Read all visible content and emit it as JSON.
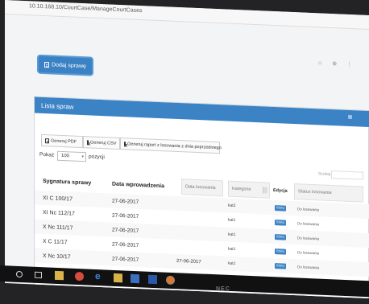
{
  "browser": {
    "url": "10.10.168.10/CourtCase/ManageCourtCases"
  },
  "toolbar": {
    "add_case_label": "Dodaj sprawę"
  },
  "panel": {
    "title": "Lista spraw",
    "export_pdf": "Generuj PDF",
    "export_csv": "Generuj CSV",
    "export_report": "Generuj raport z losowania z dnia poprzedniego",
    "show_label": "Pokaż",
    "page_size": "100",
    "entries_label": "pozycji",
    "search_label": "Szukaj"
  },
  "table": {
    "headers": {
      "signature": "Sygnatura sprawy",
      "date_entered": "Data wprowadzenia",
      "date_drawn": "Data losowania",
      "category": "Kategorie",
      "edit": "Edycja",
      "status": "Status losowania"
    },
    "rows": [
      {
        "signature": "XI C 100/17",
        "date_entered": "27-06-2017",
        "date_drawn": "",
        "category": "kat2",
        "edit": "Edytuj",
        "status": "Do losowania"
      },
      {
        "signature": "XI Nc 112/17",
        "date_entered": "27-06-2017",
        "date_drawn": "",
        "category": "kat1",
        "edit": "Edytuj",
        "status": "Do losowania"
      },
      {
        "signature": "X Nc 111/17",
        "date_entered": "27-06-2017",
        "date_drawn": "",
        "category": "kat1",
        "edit": "Edytuj",
        "status": "Do losowania"
      },
      {
        "signature": "X C 11/17",
        "date_entered": "27-06-2017",
        "date_drawn": "",
        "category": "kat1",
        "edit": "Edytuj",
        "status": "Do losowania"
      },
      {
        "signature": "X Nc 10/17",
        "date_entered": "27-06-2017",
        "date_drawn": "27-06-2017",
        "category": "kat1",
        "edit": "Edytuj",
        "status": "Do losowania"
      },
      {
        "signature": "X Nc 8/17",
        "date_entered": "27-06-2017",
        "date_drawn": "",
        "category": "kat1",
        "edit": "",
        "status": "Brak pasujących sędziów"
      }
    ]
  },
  "monitor": {
    "brand": "NEC"
  },
  "colors": {
    "accent": "#3b83c5",
    "taskbar": "#111111"
  },
  "taskbar_icons": [
    "search-icon",
    "task-view-icon",
    "file-explorer-icon",
    "chrome-icon",
    "edge-icon",
    "app-icon",
    "app-icon",
    "word-icon",
    "firefox-icon"
  ]
}
